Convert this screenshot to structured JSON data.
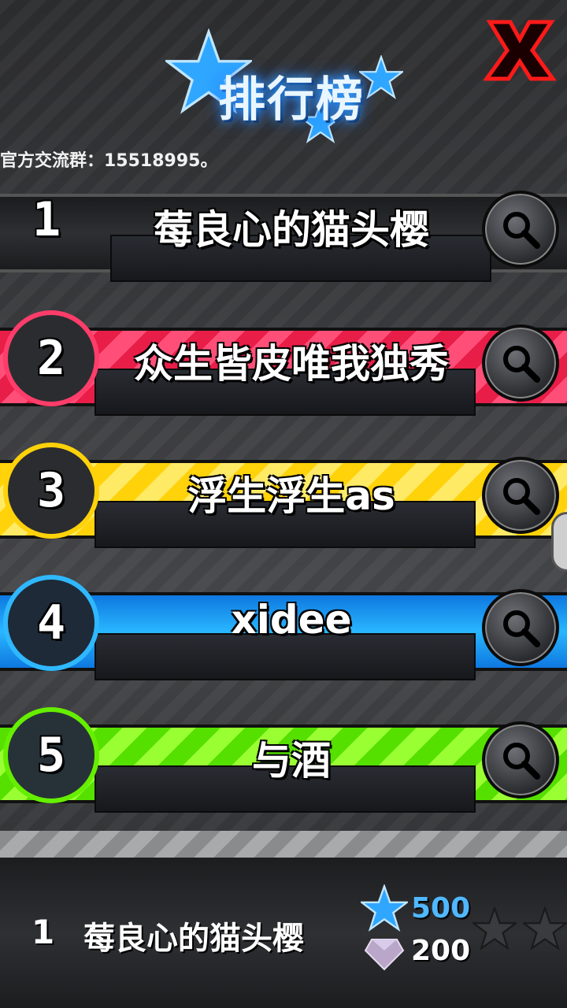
{
  "header": {
    "title": "排行榜",
    "close_icon": "close-x-icon",
    "accent": "#2f9bff"
  },
  "notice": "官方交流群：15518995。",
  "leaderboard": [
    {
      "rank": "1",
      "name": "莓良心的猫头樱",
      "theme": "gray",
      "color": "#2e2f32"
    },
    {
      "rank": "2",
      "name": "众生皆皮唯我独秀",
      "theme": "red",
      "color": "#e81e48"
    },
    {
      "rank": "3",
      "name": "浮生浮生as",
      "theme": "yellow",
      "color": "#ffd20a"
    },
    {
      "rank": "4",
      "name": "xidee",
      "theme": "blue",
      "color": "#29b6ff"
    },
    {
      "rank": "5",
      "name": "与酒",
      "theme": "green",
      "color": "#66ee00"
    }
  ],
  "self_entry": {
    "rank": "1",
    "name": "莓良心的猫头樱",
    "stars": "500",
    "gems": "200"
  }
}
